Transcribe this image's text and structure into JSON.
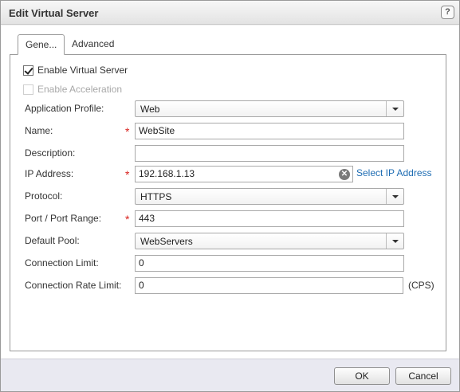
{
  "dialog": {
    "title": "Edit Virtual Server",
    "help_label": "?"
  },
  "tabs": [
    {
      "label": "Gene...",
      "active": true
    },
    {
      "label": "Advanced",
      "active": false
    }
  ],
  "form": {
    "enable_virtual_server": {
      "label": "Enable Virtual Server",
      "checked": true
    },
    "enable_acceleration": {
      "label": "Enable Acceleration",
      "checked": false,
      "disabled": true
    },
    "application_profile": {
      "label": "Application Profile:",
      "value": "Web"
    },
    "name": {
      "label": "Name:",
      "value": "WebSite",
      "required_mark": "*"
    },
    "description": {
      "label": "Description:",
      "value": ""
    },
    "ip_address": {
      "label": "IP Address:",
      "value": "192.168.1.13",
      "required_mark": "*",
      "link": "Select IP Address"
    },
    "protocol": {
      "label": "Protocol:",
      "value": "HTTPS"
    },
    "port": {
      "label": "Port / Port Range:",
      "value": "443",
      "required_mark": "*"
    },
    "default_pool": {
      "label": "Default Pool:",
      "value": "WebServers"
    },
    "connection_limit": {
      "label": "Connection Limit:",
      "value": "0"
    },
    "connection_rate_limit": {
      "label": "Connection Rate Limit:",
      "value": "0",
      "suffix": "(CPS)"
    }
  },
  "footer": {
    "ok_label": "OK",
    "cancel_label": "Cancel"
  },
  "colors": {
    "required": "#d9211d",
    "link": "#1f6db3",
    "footer_bg": "#e9e9f1"
  }
}
